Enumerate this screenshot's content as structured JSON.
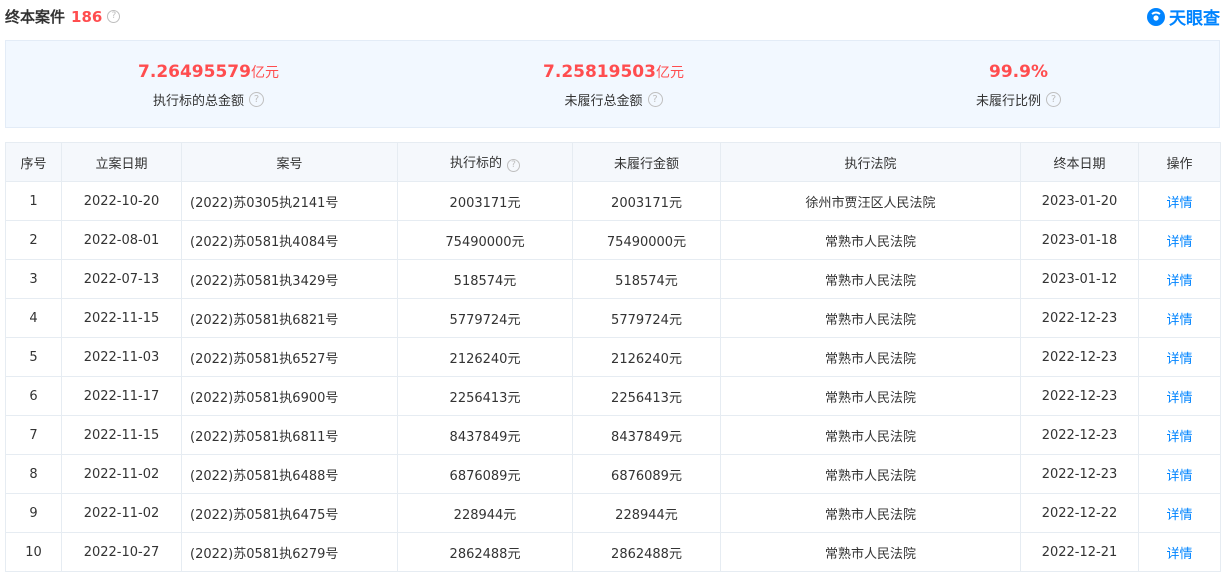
{
  "header": {
    "title": "终本案件",
    "count": "186",
    "logo_text": "天眼查"
  },
  "summary": [
    {
      "value": "7.26495579",
      "unit": "亿元",
      "label": "执行标的总金额"
    },
    {
      "value": "7.25819503",
      "unit": "亿元",
      "label": "未履行总金额"
    },
    {
      "value": "99.9%",
      "unit": "",
      "label": "未履行比例"
    }
  ],
  "table": {
    "columns": [
      "序号",
      "立案日期",
      "案号",
      "执行标的",
      "未履行金额",
      "执行法院",
      "终本日期",
      "操作"
    ],
    "rows": [
      {
        "no": "1",
        "filed": "2022-10-20",
        "case": "(2022)苏0305执2141号",
        "target": "2003171元",
        "unpaid": "2003171元",
        "court": "徐州市贾汪区人民法院",
        "end": "2023-01-20",
        "action": "详情"
      },
      {
        "no": "2",
        "filed": "2022-08-01",
        "case": "(2022)苏0581执4084号",
        "target": "75490000元",
        "unpaid": "75490000元",
        "court": "常熟市人民法院",
        "end": "2023-01-18",
        "action": "详情"
      },
      {
        "no": "3",
        "filed": "2022-07-13",
        "case": "(2022)苏0581执3429号",
        "target": "518574元",
        "unpaid": "518574元",
        "court": "常熟市人民法院",
        "end": "2023-01-12",
        "action": "详情"
      },
      {
        "no": "4",
        "filed": "2022-11-15",
        "case": "(2022)苏0581执6821号",
        "target": "5779724元",
        "unpaid": "5779724元",
        "court": "常熟市人民法院",
        "end": "2022-12-23",
        "action": "详情"
      },
      {
        "no": "5",
        "filed": "2022-11-03",
        "case": "(2022)苏0581执6527号",
        "target": "2126240元",
        "unpaid": "2126240元",
        "court": "常熟市人民法院",
        "end": "2022-12-23",
        "action": "详情"
      },
      {
        "no": "6",
        "filed": "2022-11-17",
        "case": "(2022)苏0581执6900号",
        "target": "2256413元",
        "unpaid": "2256413元",
        "court": "常熟市人民法院",
        "end": "2022-12-23",
        "action": "详情"
      },
      {
        "no": "7",
        "filed": "2022-11-15",
        "case": "(2022)苏0581执6811号",
        "target": "8437849元",
        "unpaid": "8437849元",
        "court": "常熟市人民法院",
        "end": "2022-12-23",
        "action": "详情"
      },
      {
        "no": "8",
        "filed": "2022-11-02",
        "case": "(2022)苏0581执6488号",
        "target": "6876089元",
        "unpaid": "6876089元",
        "court": "常熟市人民法院",
        "end": "2022-12-23",
        "action": "详情"
      },
      {
        "no": "9",
        "filed": "2022-11-02",
        "case": "(2022)苏0581执6475号",
        "target": "228944元",
        "unpaid": "228944元",
        "court": "常熟市人民法院",
        "end": "2022-12-22",
        "action": "详情"
      },
      {
        "no": "10",
        "filed": "2022-10-27",
        "case": "(2022)苏0581执6279号",
        "target": "2862488元",
        "unpaid": "2862488元",
        "court": "常熟市人民法院",
        "end": "2022-12-21",
        "action": "详情"
      }
    ]
  },
  "colors": {
    "accent": "#ff4d4f",
    "link": "#0084ff",
    "summary_bg": "#f2f8ff",
    "header_bg": "#f5f8fc"
  },
  "icons": {
    "help": "question-circle-icon",
    "logo": "tianyancha-logo-icon"
  }
}
